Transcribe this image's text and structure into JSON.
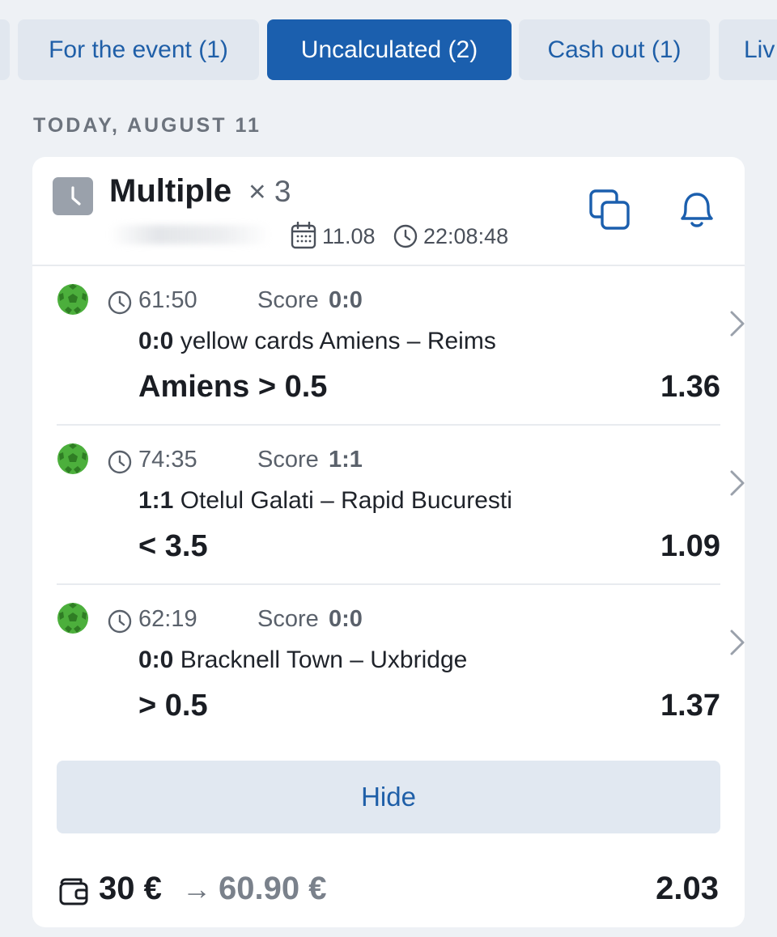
{
  "tabs": {
    "event": "For the event (1)",
    "uncalculated": "Uncalculated (2)",
    "cashout": "Cash out (1)",
    "live": "Liv"
  },
  "date_header": "TODAY, AUGUST 11",
  "bet": {
    "title": "Multiple",
    "multiplier": "× 3",
    "date": "11.08",
    "time": "22:08:48"
  },
  "events": [
    {
      "time": "61:50",
      "score_label": "Score",
      "score": "0:0",
      "match_score": "0:0",
      "match": "yellow cards Amiens – Reims",
      "pick": "Amiens > 0.5",
      "odds": "1.36"
    },
    {
      "time": "74:35",
      "score_label": "Score",
      "score": "1:1",
      "match_score": "1:1",
      "match": "Otelul Galati – Rapid Bucuresti",
      "pick": "< 3.5",
      "odds": "1.09"
    },
    {
      "time": "62:19",
      "score_label": "Score",
      "score": "0:0",
      "match_score": "0:0",
      "match": "Bracknell Town – Uxbridge",
      "pick": "> 0.5",
      "odds": "1.37"
    }
  ],
  "hide_label": "Hide",
  "footer": {
    "stake": "30 €",
    "arrow": "→",
    "payout": "60.90 €",
    "total_odds": "2.03"
  },
  "colors": {
    "accent": "#1b5fae",
    "tab_bg": "#e1e7ef",
    "ball_green": "#4caf3c"
  },
  "icons": [
    "clock-icon",
    "calendar-icon",
    "copy-icon",
    "bell-icon",
    "football-icon",
    "chevron-right-icon",
    "wallet-icon"
  ]
}
